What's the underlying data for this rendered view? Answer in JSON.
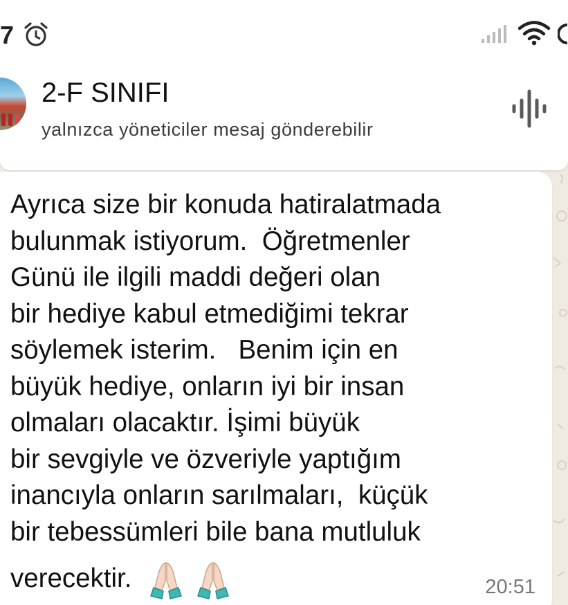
{
  "status_bar": {
    "time": "7",
    "icons": [
      "alarm-icon",
      "signal-icon",
      "wifi-icon",
      "battery-icon"
    ]
  },
  "header": {
    "title": "2-F SINIFI",
    "subtitle": "yalnızca yöneticiler mesaj gönderebilir",
    "avatar_icon": "group-avatar",
    "action_icon": "voice-chat-icon"
  },
  "message": {
    "lines": [
      "Ayrıca size bir konuda hatiralatmada",
      "bulunmak istiyorum.  Öğretmenler",
      "Günü ile ilgili maddi değeri olan",
      "bir hediye kabul etmediğimi tekrar",
      "söylemek isterim.   Benim için en",
      "büyük hediye, onların iyi bir insan",
      "olmaları olacaktır. İşimi büyük",
      "bir sevgiyle ve özveriyle yaptığım",
      "inancıyla onların sarılmaları,  küçük",
      "bir tebessümleri bile bana mutluluk"
    ],
    "last_line": "verecektir.",
    "emojis": [
      "folded-hands-icon",
      "folded-hands-icon"
    ],
    "time": "20:51"
  },
  "colors": {
    "chat_background": "#efeae2",
    "bubble": "#ffffff",
    "text": "#111111",
    "timestamp": "#777777"
  }
}
